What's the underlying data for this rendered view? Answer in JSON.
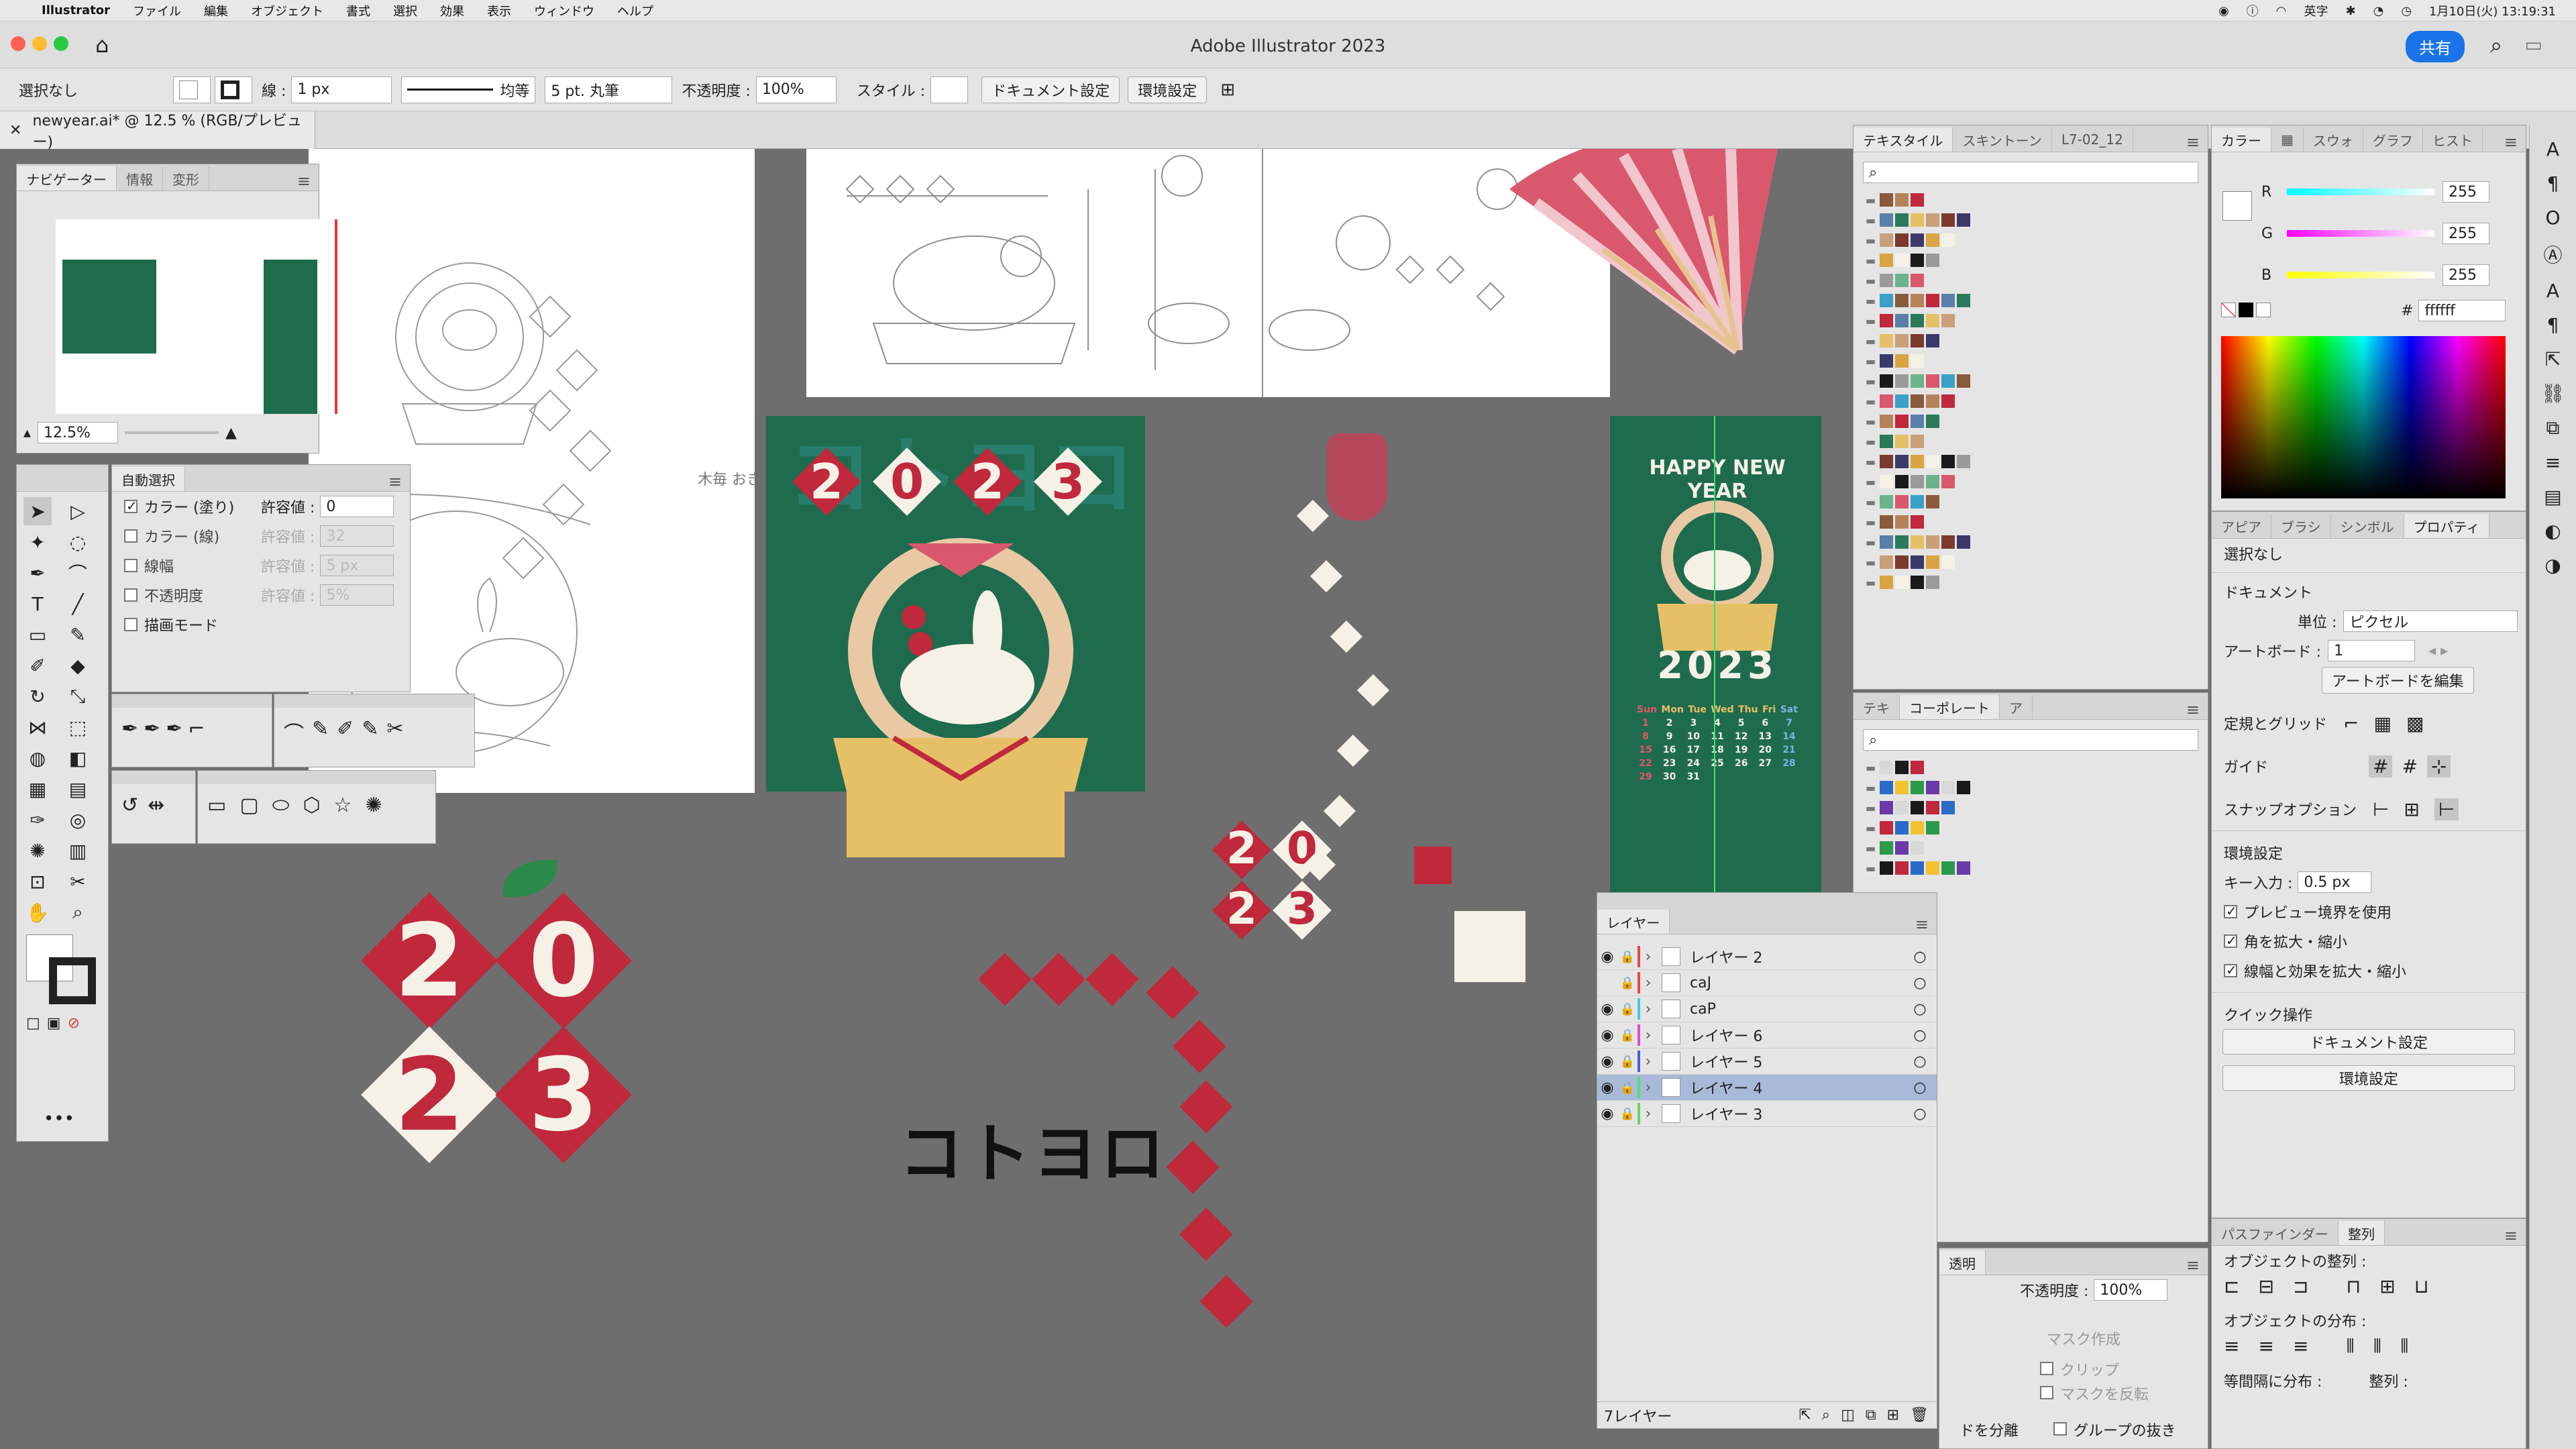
{
  "menubar": {
    "app": "Illustrator",
    "items": [
      "ファイル",
      "編集",
      "オブジェクト",
      "書式",
      "選択",
      "効果",
      "表示",
      "ウィンドウ",
      "ヘルプ"
    ],
    "ime": "英字",
    "datetime": "1月10日(火) 13:19:31"
  },
  "window": {
    "title": "Adobe Illustrator 2023",
    "share": "共有"
  },
  "control": {
    "selection": "選択なし",
    "stroke_label": "線 :",
    "stroke_value": "1 px",
    "profile": "均等",
    "brush": "5 pt. 丸筆",
    "opacity_label": "不透明度 :",
    "opacity": "100%",
    "style_label": "スタイル :",
    "doc_setup": "ドキュメント設定",
    "prefs": "環境設定"
  },
  "doc_tab": "newyear.ai* @ 12.5 % (RGB/プレビュー)",
  "navigator": {
    "tabs": [
      "ナビゲーター",
      "情報",
      "変形"
    ],
    "zoom": "12.5%"
  },
  "magic_wand": {
    "title": "自動選択",
    "rows": [
      {
        "label": "カラー (塗り)",
        "checked": true,
        "tol_label": "許容値 :",
        "tol": "0",
        "enabled": true
      },
      {
        "label": "カラー (線)",
        "checked": false,
        "tol_label": "許容値 :",
        "tol": "32",
        "enabled": false
      },
      {
        "label": "線幅",
        "checked": false,
        "tol_label": "許容値 :",
        "tol": "5 px",
        "enabled": false
      },
      {
        "label": "不透明度",
        "checked": false,
        "tol_label": "許容値 :",
        "tol": "5%",
        "enabled": false
      },
      {
        "label": "描画モード",
        "checked": false,
        "tol_label": "",
        "tol": "",
        "enabled": true
      }
    ]
  },
  "swatch_panel": {
    "tabs": [
      "テキスタイル",
      "スキントーン",
      "L7-02_12"
    ]
  },
  "swatch_panel2": {
    "tabs": [
      "テキ",
      "コーポレート",
      "ア"
    ]
  },
  "color_panel": {
    "tabs": [
      "カラー",
      "",
      "スウォ",
      "グラフ",
      "ヒスト"
    ],
    "channels": [
      {
        "name": "R",
        "value": "255"
      },
      {
        "name": "G",
        "value": "255"
      },
      {
        "name": "B",
        "value": "255"
      }
    ],
    "hex_label": "#",
    "hex": "ffffff"
  },
  "properties": {
    "tabs": [
      "アピア",
      "ブラシ",
      "シンボル",
      "プロパティ"
    ],
    "selection": "選択なし",
    "document": "ドキュメント",
    "unit_label": "単位 :",
    "unit": "ピクセル",
    "artboard_label": "アートボード :",
    "artboard": "1",
    "edit_artboard": "アートボードを編集",
    "rulers": "定規とグリッド",
    "guides": "ガイド",
    "snap": "スナップオプション",
    "prefs_title": "環境設定",
    "key_label": "キー入力 :",
    "key_value": "0.5 px",
    "checks": [
      "プレビュー境界を使用",
      "角を拡大・縮小",
      "線幅と効果を拡大・縮小"
    ],
    "quick": "クイック操作",
    "quick_doc": "ドキュメント設定",
    "quick_prefs": "環境設定"
  },
  "align_panel": {
    "tabs": [
      "パスファインダー",
      "整列"
    ],
    "align_objects": "オブジェクトの整列 :",
    "distribute_objects": "オブジェクトの分布 :",
    "distribute_spacing": "等間隔に分布 :",
    "align_to": "整列 :"
  },
  "transparency": {
    "tab": "透明",
    "opacity_label": "不透明度 :",
    "opacity": "100%",
    "mask": "マスク作成",
    "clip": "クリップ",
    "invert": "マスクを反転",
    "knockout": "グループの抜き",
    "isolate": "ドを分離"
  },
  "layers": {
    "title": "レイヤー",
    "items": [
      {
        "name": "レイヤー 2",
        "color": "#e14b4b",
        "visible": true,
        "selected": false
      },
      {
        "name": "caJ",
        "color": "#e14b4b",
        "visible": false,
        "selected": false
      },
      {
        "name": "caP",
        "color": "#4bc6e1",
        "visible": true,
        "selected": false
      },
      {
        "name": "レイヤー 6",
        "color": "#e14bd3",
        "visible": true,
        "selected": false
      },
      {
        "name": "レイヤー 5",
        "color": "#4b5be1",
        "visible": true,
        "selected": false
      },
      {
        "name": "レイヤー 4",
        "color": "#4be17a",
        "visible": true,
        "selected": true
      },
      {
        "name": "レイヤー 3",
        "color": "#6bd36b",
        "visible": true,
        "selected": false
      }
    ],
    "count": "7レイヤー"
  },
  "artwork": {
    "year": "2023",
    "digits_top": [
      "2",
      "0",
      "2",
      "3"
    ],
    "digits_big": [
      "2",
      "0",
      "2",
      "3"
    ],
    "kotoyoro": "コトヨロ",
    "happy": "HAPPY NEW YEAR",
    "calendar_head": [
      "Sun",
      "Mon",
      "Tue",
      "Wed",
      "Thu",
      "Fri",
      "Sat"
    ],
    "calendar_rows": [
      [
        "1",
        "2",
        "3",
        "4",
        "5",
        "6",
        "7"
      ],
      [
        "8",
        "9",
        "10",
        "11",
        "12",
        "13",
        "14"
      ],
      [
        "15",
        "16",
        "17",
        "18",
        "19",
        "20",
        "21"
      ],
      [
        "22",
        "23",
        "24",
        "25",
        "26",
        "27",
        "28"
      ],
      [
        "29",
        "30",
        "31",
        "",
        "",
        "",
        ""
      ]
    ],
    "sketch_note": "木毎 おき"
  },
  "colors": {
    "green": "#1f6b4e",
    "red": "#c0283c",
    "cream": "#f6f1e7",
    "gold": "#e6c066",
    "fan": "#d9586d"
  }
}
